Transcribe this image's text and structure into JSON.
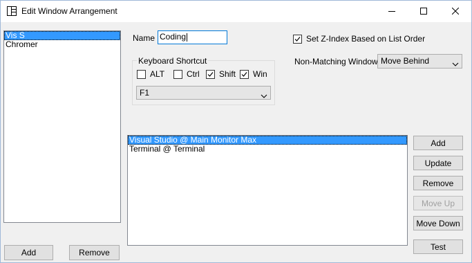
{
  "window": {
    "title": "Edit Window Arrangement",
    "colors": {
      "accent": "#0078d7",
      "selection": "#3399ff",
      "face": "#f0f0f0"
    }
  },
  "arrangements": {
    "items": [
      "Vis S",
      "Chromer"
    ],
    "selected_index": 0,
    "add_label": "Add",
    "remove_label": "Remove"
  },
  "name": {
    "label": "Name",
    "value": "Coding"
  },
  "shortcut": {
    "group_label": "Keyboard Shortcut",
    "alt": {
      "label": "ALT",
      "checked": false
    },
    "ctrl": {
      "label": "Ctrl",
      "checked": false
    },
    "shift": {
      "label": "Shift",
      "checked": true
    },
    "win": {
      "label": "Win",
      "checked": true
    },
    "key_value": "F1"
  },
  "zindex": {
    "label": "Set Z-Index Based on List Order",
    "checked": true
  },
  "nonmatching": {
    "label": "Non-Matching Windows:",
    "value": "Move Behind"
  },
  "windows": {
    "items": [
      "Visual Studio @ Main Monitor Max",
      "Terminal @ Terminal"
    ],
    "selected_index": 0
  },
  "buttons": {
    "add": "Add",
    "update": "Update",
    "remove": "Remove",
    "move_up": "Move Up",
    "move_down": "Move Down",
    "test": "Test"
  }
}
